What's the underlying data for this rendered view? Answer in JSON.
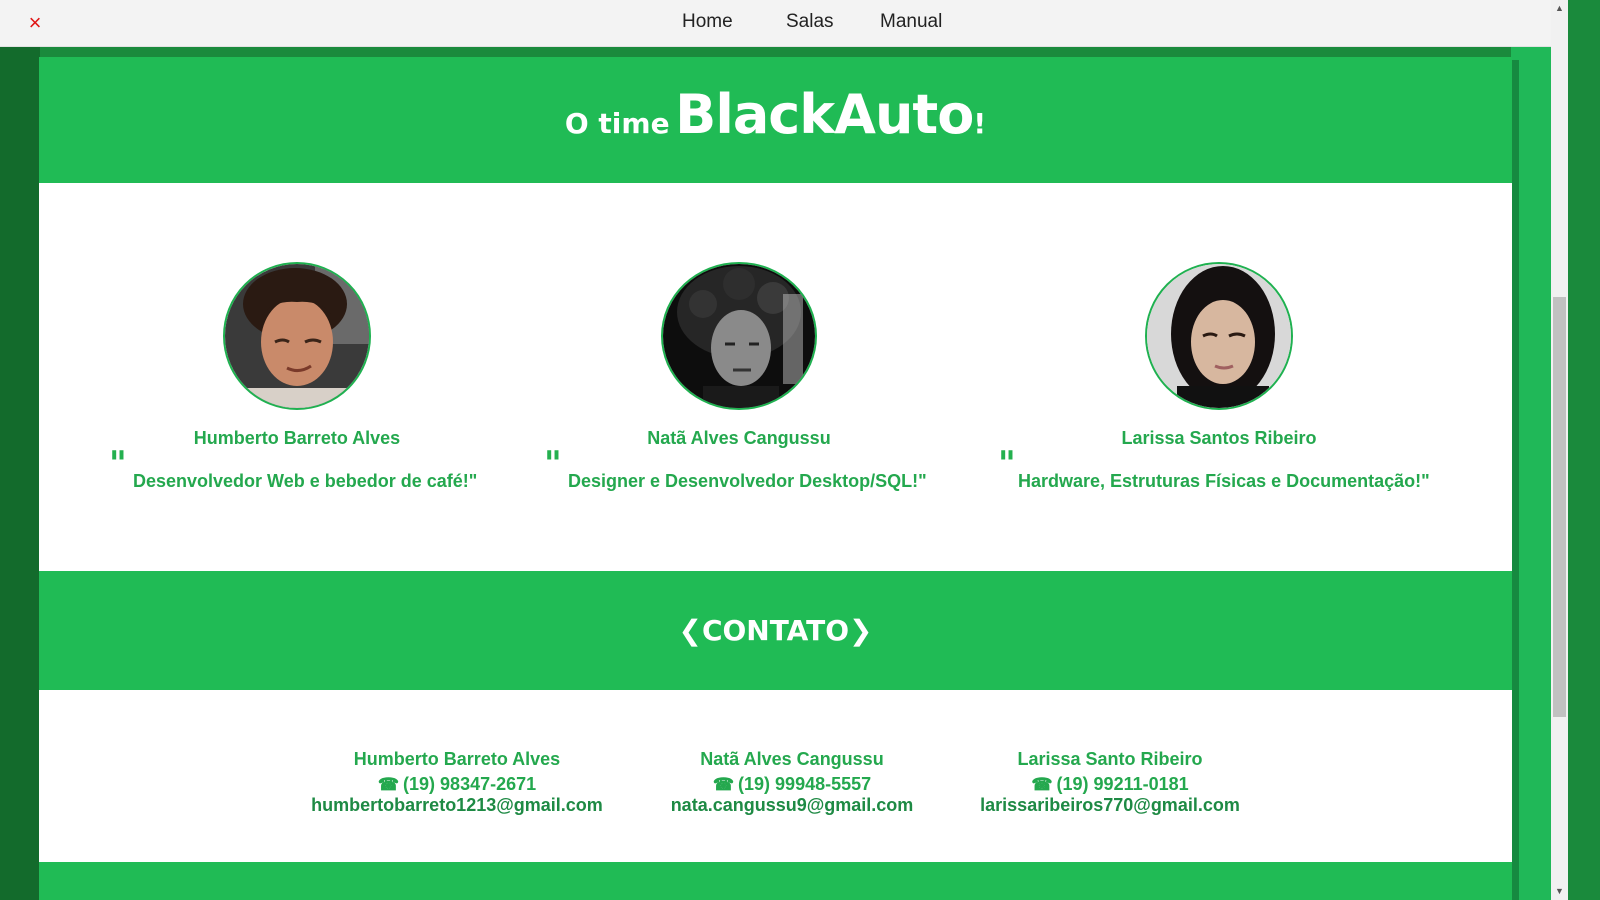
{
  "nav": {
    "close_icon": "×",
    "items": [
      {
        "label": "Home"
      },
      {
        "label": "Salas"
      },
      {
        "label": "Manual"
      }
    ]
  },
  "team": {
    "title_prefix": "O time",
    "brand": "BlackAuto",
    "title_suffix": "!",
    "quote_mark": "\"",
    "members": [
      {
        "name": "Humberto Barreto Alves",
        "quote": "Desenvolvedor Web e bebedor de café!\""
      },
      {
        "name": "Natã Alves Cangussu",
        "quote": "Designer e Desenvolvedor Desktop/SQL!\""
      },
      {
        "name": "Larissa Santos Ribeiro",
        "quote": "Hardware, Estruturas Físicas e Documentação!\""
      }
    ]
  },
  "contact": {
    "title": "❮CONTATO❯",
    "phone_icon": "☎",
    "people": [
      {
        "name": "Humberto Barreto Alves",
        "phone": "(19) 98347-2671",
        "email": "humbertobarreto1213@gmail.com"
      },
      {
        "name": "Natã Alves Cangussu",
        "phone": "(19) 99948-5557",
        "email": "nata.cangussu9@gmail.com"
      },
      {
        "name": "Larissa Santo Ribeiro",
        "phone": "(19) 99211-0181",
        "email": "larissaribeiros770@gmail.com"
      }
    ]
  },
  "colors": {
    "accent_green": "#20bb55",
    "text_green": "#24a84e",
    "dark_green": "#136b2c",
    "close_red": "#e01515"
  },
  "scrollbar": {
    "up_icon": "▲",
    "down_icon": "▼"
  }
}
